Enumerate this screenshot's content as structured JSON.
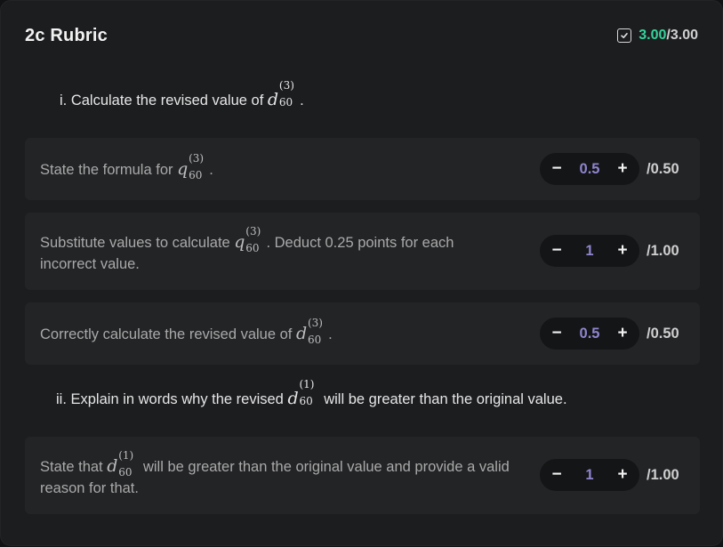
{
  "header": {
    "title": "2c Rubric",
    "score_got": "3.00",
    "score_total": "/3.00",
    "check_icon": "checkbox-icon"
  },
  "sections": [
    {
      "heading_prefix": "i. Calculate the revised value of ",
      "heading_suffix": ".",
      "heading_math": {
        "base": "d",
        "sup": "(3)",
        "sub": "60"
      },
      "items": [
        {
          "text_prefix": "State the formula for ",
          "math": {
            "base": "q",
            "sup": "(3)",
            "sub": "60"
          },
          "text_suffix": ".",
          "value": "0.5",
          "max": "/0.50"
        },
        {
          "text_prefix": "Substitute values to calculate ",
          "math": {
            "base": "q",
            "sup": "(3)",
            "sub": "60"
          },
          "text_suffix": ". Deduct 0.25 points for each incorrect value.",
          "value": "1",
          "max": "/1.00"
        },
        {
          "text_prefix": "Correctly calculate the revised value of ",
          "math": {
            "base": "d",
            "sup": "(3)",
            "sub": "60"
          },
          "text_suffix": ".",
          "value": "0.5",
          "max": "/0.50"
        }
      ]
    },
    {
      "heading_prefix": "ii. Explain in words why the revised ",
      "heading_suffix": " will be greater than the original value.",
      "heading_math": {
        "base": "d",
        "sup": "(1)",
        "sub": "60"
      },
      "items": [
        {
          "text_prefix": "State that ",
          "math": {
            "base": "d",
            "sup": "(1)",
            "sub": "60"
          },
          "text_suffix": " will be greater than the original value and provide a valid reason for that.",
          "value": "1",
          "max": "/1.00"
        }
      ]
    }
  ],
  "stepper": {
    "minus": "−",
    "plus": "+"
  },
  "colors": {
    "accent_score": "#35d29a",
    "stepper_value": "#8e85cf",
    "background": "#1c1d1f"
  }
}
